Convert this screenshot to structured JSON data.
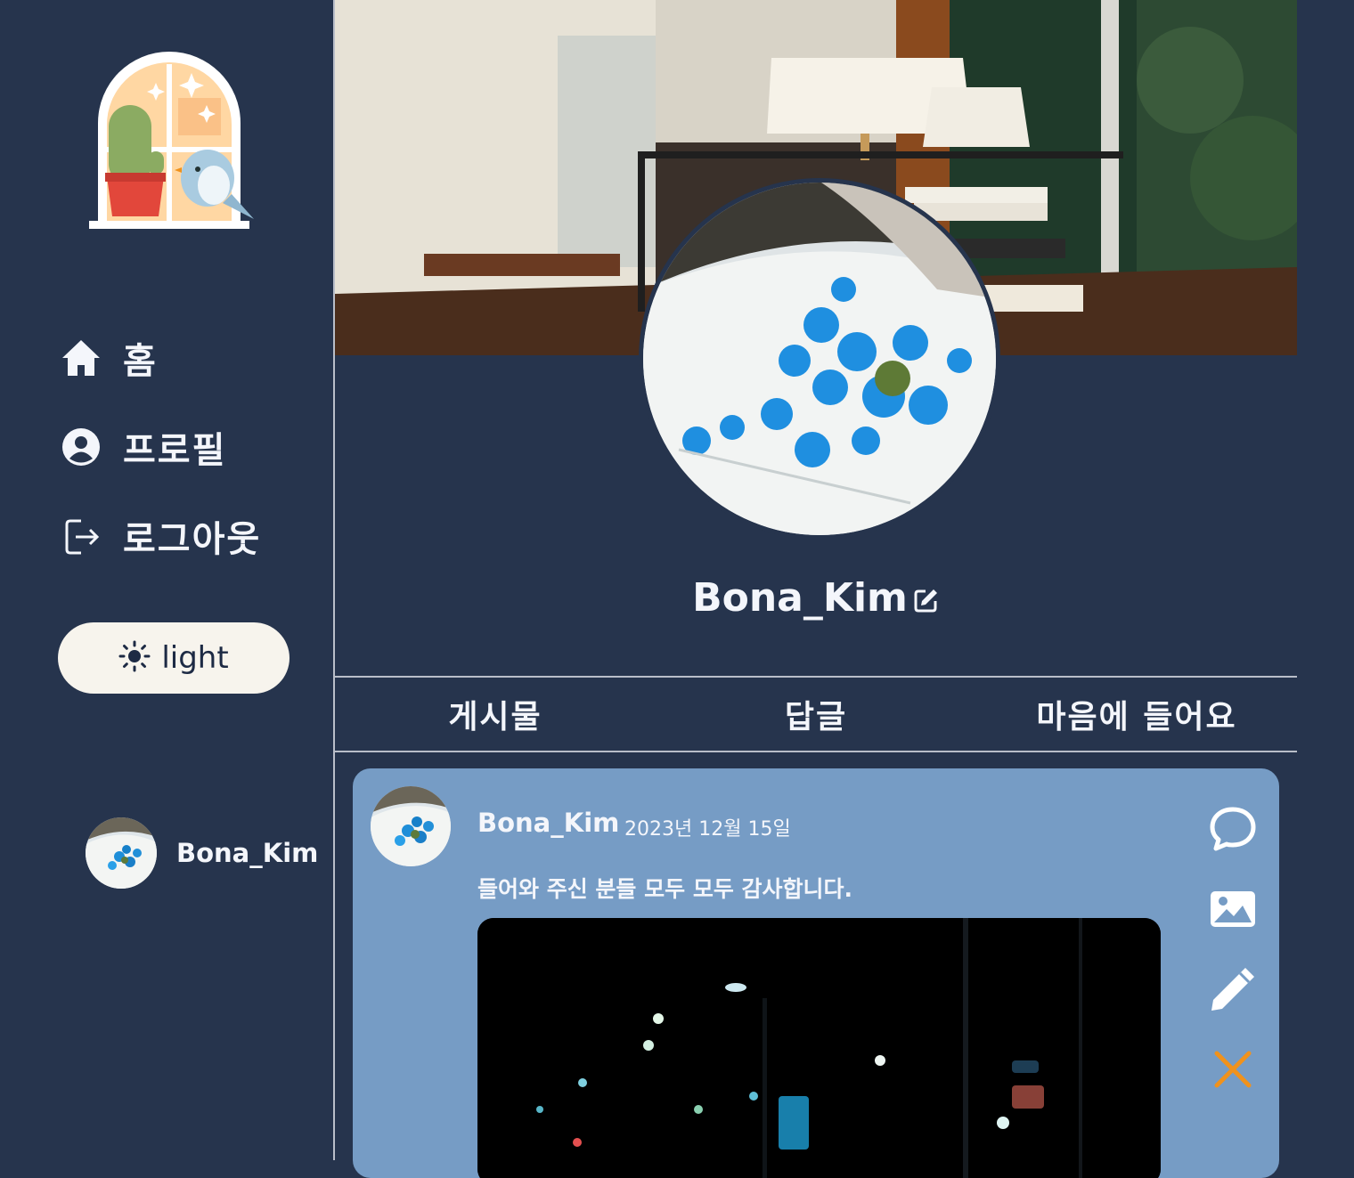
{
  "sidebar": {
    "nav": [
      {
        "label": "홈",
        "icon": "home-icon"
      },
      {
        "label": "프로필",
        "icon": "user-circle-icon"
      },
      {
        "label": "로그아웃",
        "icon": "logout-icon"
      }
    ],
    "theme_toggle": {
      "label": "light",
      "icon": "sun-icon"
    },
    "current_user": {
      "name": "Bona_Kim"
    }
  },
  "profile": {
    "username": "Bona_Kim"
  },
  "tabs": [
    "게시물",
    "답글",
    "마음에 들어요"
  ],
  "posts": [
    {
      "author": "Bona_Kim",
      "date": "2023년 12월 15일",
      "text": "들어와 주신 분들 모두 모두 감사합니다."
    }
  ],
  "colors": {
    "background": "#26344d",
    "card": "#769cc5",
    "delete_accent": "#f0921c",
    "button_bg": "#f7f4ed"
  }
}
